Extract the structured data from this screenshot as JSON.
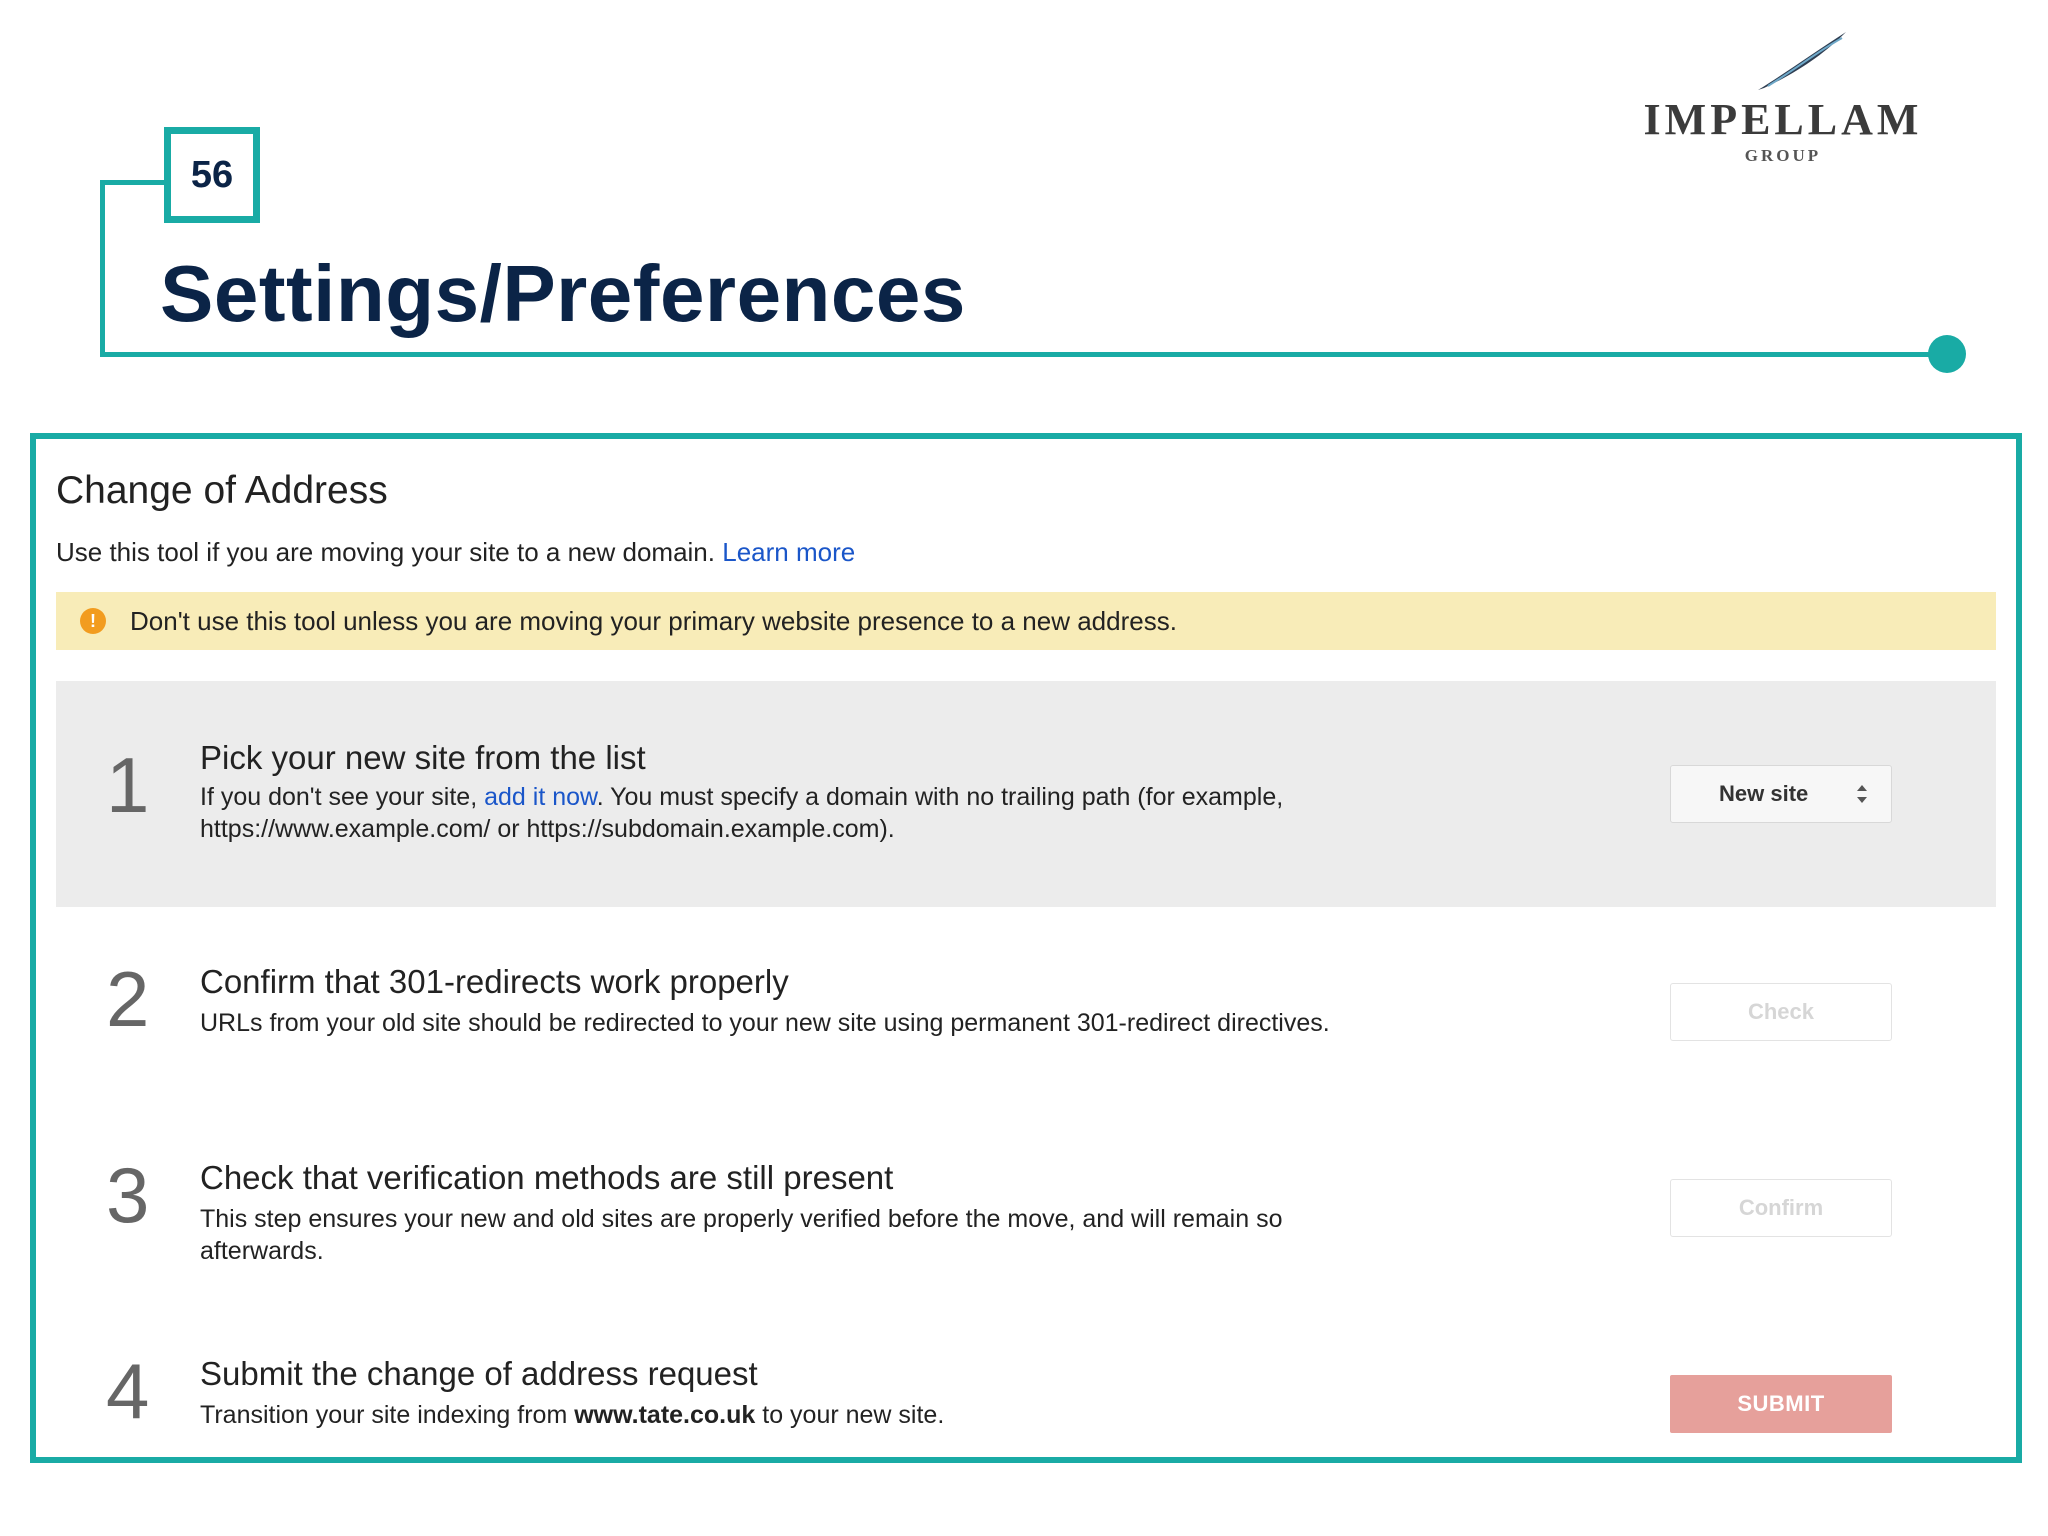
{
  "slide": {
    "page_number": "56",
    "title": "Settings/Preferences",
    "accent_color": "#19aba5",
    "title_color": "#0b2447"
  },
  "logo": {
    "name": "IMPELLAM",
    "subtitle": "GROUP"
  },
  "tool": {
    "heading": "Change of Address",
    "intro": "Use this tool if you are moving your site to a new domain.",
    "learn_more": "Learn more",
    "warning": "Don't use this tool unless you are moving your primary website presence to a new address.",
    "steps": [
      {
        "number": "1",
        "title": "Pick your new site from the list",
        "desc_before_link": "If you don't see your site, ",
        "desc_link": "add it now",
        "desc_after_link": ". You must specify a domain with no trailing path (for example, https://www.example.com/ or https://subdomain.example.com).",
        "control_label": "New site"
      },
      {
        "number": "2",
        "title": "Confirm that 301-redirects work properly",
        "desc": "URLs from your old site should be redirected to your new site using permanent 301-redirect directives.",
        "control_label": "Check"
      },
      {
        "number": "3",
        "title": "Check that verification methods are still present",
        "desc": "This step ensures your new and old sites are properly verified before the move, and will remain so afterwards.",
        "control_label": "Confirm"
      },
      {
        "number": "4",
        "title": "Submit the change of address request",
        "desc_before": "Transition your site indexing from ",
        "desc_domain": "www.tate.co.uk",
        "desc_after": " to your new site.",
        "control_label": "SUBMIT"
      }
    ]
  }
}
